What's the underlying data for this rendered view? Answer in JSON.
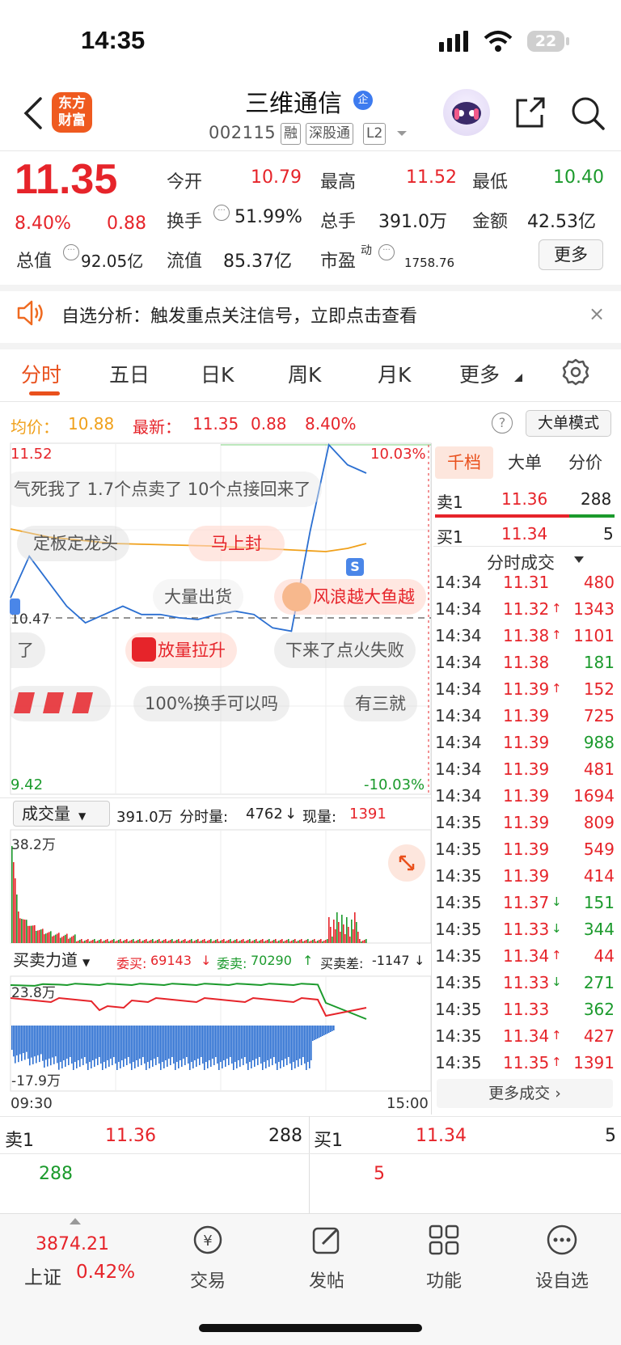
{
  "status": {
    "time": "14:35",
    "battery": "22"
  },
  "header": {
    "logo": [
      "东方",
      "财富"
    ],
    "stock_name": "三维通信",
    "badge": "企",
    "code": "002115",
    "tags": [
      "融",
      "深股通",
      "L2"
    ]
  },
  "quote": {
    "price": "11.35",
    "change_pct": "8.40%",
    "change": "0.88",
    "fields": {
      "open_label": "今开",
      "open": "10.79",
      "high_label": "最高",
      "high": "11.52",
      "low_label": "最低",
      "low": "10.40",
      "turnover_label": "换手",
      "turnover": "51.99%",
      "volume_label": "总手",
      "volume": "391.0万",
      "amount_label": "金额",
      "amount": "42.53亿",
      "mktcap_label": "总值",
      "mktcap": "92.05亿",
      "float_label": "流值",
      "float": "85.37亿",
      "pe_label": "市盈",
      "pe_sup": "动",
      "pe": "1758.76"
    },
    "more_label": "更多"
  },
  "alert": {
    "text": "自选分析：触发重点关注信号，立即点击查看",
    "close": "×"
  },
  "tabs": [
    "分时",
    "五日",
    "日K",
    "周K",
    "月K",
    "更多"
  ],
  "info": {
    "avg_label": "均价：",
    "avg": "10.88",
    "last_label": "最新：",
    "last": "11.35",
    "chg": "0.88",
    "chg_pct": "8.40%",
    "big_mode": "大单模式"
  },
  "chart": {
    "top_left": "11.52",
    "top_right": "10.03%",
    "bottom_left": "9.42",
    "bottom_right": "-10.03%",
    "mid_left": "10.47",
    "marker": "S",
    "danmu": [
      "气死我了 1.7个点卖了 10个点接回来了",
      "定板定龙头",
      "马上封",
      "大量出货",
      "风浪越大鱼越",
      "了",
      "放量拉升",
      "下来了点火失败",
      "100%换手可以吗",
      "有三就"
    ]
  },
  "price_chart_data": {
    "type": "line",
    "series": [
      {
        "values": [
          10.6,
          10.85,
          10.7,
          10.55,
          10.45,
          10.5,
          10.55,
          10.5,
          10.5,
          10.48,
          10.47,
          10.5,
          10.52,
          10.5,
          10.42,
          10.4,
          11.0,
          11.52,
          11.4,
          11.35
        ]
      }
    ],
    "ylim": [
      9.42,
      11.52
    ]
  },
  "volume": {
    "label": "成交量",
    "summary": "391.0万",
    "fenshi_label": "分时量:",
    "fenshi_val": "4762",
    "cur_label": "现量:",
    "cur_val": "1391",
    "max": "38.2万"
  },
  "force": {
    "label": "买卖力道",
    "bid_label": "委买:",
    "bid": "69143",
    "ask_label": "委卖:",
    "ask": "70290",
    "diff_label": "买卖差:",
    "diff": "-1147",
    "top": "23.8万",
    "bottom": "-17.9万",
    "time_start": "09:30",
    "time_end": "15:00"
  },
  "right_panel": {
    "tabs": [
      "千档",
      "大单",
      "分价"
    ],
    "sell1": {
      "label": "卖1",
      "price": "11.36",
      "vol": "288"
    },
    "buy1": {
      "label": "买1",
      "price": "11.34",
      "vol": "5"
    },
    "trades_title": "分时成交",
    "trades": [
      {
        "time": "14:34",
        "price": "11.31",
        "arrow": "",
        "vol": "480",
        "pc": "red",
        "vc": "red"
      },
      {
        "time": "14:34",
        "price": "11.32",
        "arrow": "↑",
        "vol": "1343",
        "pc": "red",
        "vc": "red"
      },
      {
        "time": "14:34",
        "price": "11.38",
        "arrow": "↑",
        "vol": "1101",
        "pc": "red",
        "vc": "red"
      },
      {
        "time": "14:34",
        "price": "11.38",
        "arrow": "",
        "vol": "181",
        "pc": "red",
        "vc": "green"
      },
      {
        "time": "14:34",
        "price": "11.39",
        "arrow": "↑",
        "vol": "152",
        "pc": "red",
        "vc": "red"
      },
      {
        "time": "14:34",
        "price": "11.39",
        "arrow": "",
        "vol": "725",
        "pc": "red",
        "vc": "red"
      },
      {
        "time": "14:34",
        "price": "11.39",
        "arrow": "",
        "vol": "988",
        "pc": "red",
        "vc": "green"
      },
      {
        "time": "14:34",
        "price": "11.39",
        "arrow": "",
        "vol": "481",
        "pc": "red",
        "vc": "red"
      },
      {
        "time": "14:34",
        "price": "11.39",
        "arrow": "",
        "vol": "1694",
        "pc": "red",
        "vc": "red"
      },
      {
        "time": "14:35",
        "price": "11.39",
        "arrow": "",
        "vol": "809",
        "pc": "red",
        "vc": "red"
      },
      {
        "time": "14:35",
        "price": "11.39",
        "arrow": "",
        "vol": "549",
        "pc": "red",
        "vc": "red"
      },
      {
        "time": "14:35",
        "price": "11.39",
        "arrow": "",
        "vol": "414",
        "pc": "red",
        "vc": "red"
      },
      {
        "time": "14:35",
        "price": "11.37",
        "arrow": "↓",
        "vol": "151",
        "pc": "red",
        "vc": "green"
      },
      {
        "time": "14:35",
        "price": "11.33",
        "arrow": "↓",
        "vol": "344",
        "pc": "red",
        "vc": "green"
      },
      {
        "time": "14:35",
        "price": "11.34",
        "arrow": "↑",
        "vol": "44",
        "pc": "red",
        "vc": "red"
      },
      {
        "time": "14:35",
        "price": "11.33",
        "arrow": "↓",
        "vol": "271",
        "pc": "red",
        "vc": "green"
      },
      {
        "time": "14:35",
        "price": "11.33",
        "arrow": "",
        "vol": "362",
        "pc": "red",
        "vc": "green"
      },
      {
        "time": "14:35",
        "price": "11.34",
        "arrow": "↑",
        "vol": "427",
        "pc": "red",
        "vc": "red"
      },
      {
        "time": "14:35",
        "price": "11.35",
        "arrow": "↑",
        "vol": "1391",
        "pc": "red",
        "vc": "red"
      }
    ],
    "more_trades": "更多成交"
  },
  "orderbook": {
    "sell": {
      "label": "卖1",
      "price": "11.36",
      "vol": "288",
      "sub": "288"
    },
    "buy": {
      "label": "买1",
      "price": "11.34",
      "vol": "5",
      "sub": "5"
    }
  },
  "bottom_nav": {
    "index_value": "3874.21",
    "index_name": "上证",
    "index_pct": "0.42%",
    "items": [
      "交易",
      "发帖",
      "功能",
      "设自选"
    ]
  },
  "colors": {
    "up": "#e6242a",
    "down": "#1b9a2c",
    "avg": "#f0a01a",
    "accent": "#e9501c",
    "price_line": "#2b6fd1"
  }
}
